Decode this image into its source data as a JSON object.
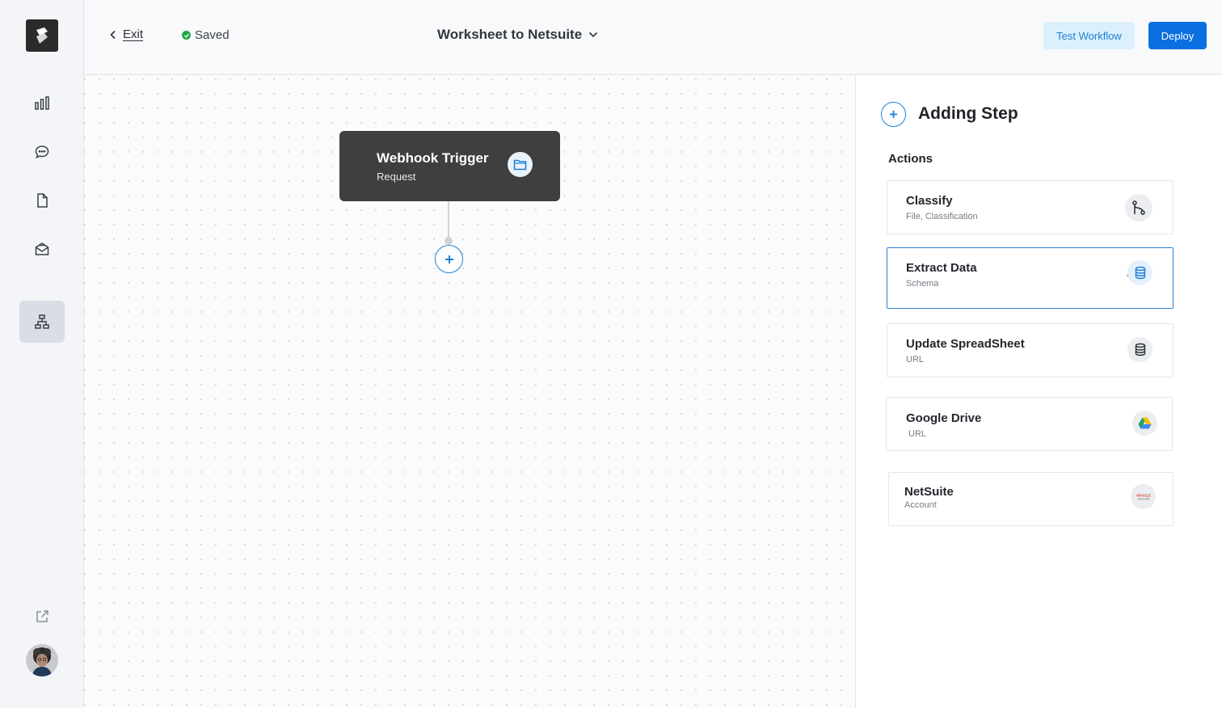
{
  "topbar": {
    "exit_label": "Exit",
    "saved_label": "Saved",
    "workflow_title": "Worksheet to Netsuite",
    "test_button": "Test Workflow",
    "deploy_button": "Deploy"
  },
  "canvas": {
    "trigger": {
      "title": "Webhook Trigger",
      "subtitle": "Request"
    }
  },
  "panel": {
    "title": "Adding Step",
    "section_label": "Actions",
    "cards": [
      {
        "title": "Classify",
        "subtitle": "File, Classification",
        "icon": "git-branch-icon"
      },
      {
        "title": "Extract Data",
        "subtitle": "Schema",
        "icon": "database-icon"
      },
      {
        "title": "Update SpreadSheet",
        "subtitle": "URL",
        "icon": "database-icon"
      },
      {
        "title": "Google Drive",
        "subtitle": "URL",
        "icon": "google-drive-icon"
      },
      {
        "title": "NetSuite",
        "subtitle": "Account",
        "icon": "oracle-netsuite-logo"
      }
    ]
  },
  "colors": {
    "accent": "#0a6fe0",
    "accent_light": "#dcf0fb",
    "trigger_bg": "#3f3f3f",
    "saved_green": "#22a845"
  },
  "logo_text": {
    "netsuite_logo_lettering": "ORACLE NETSUITE"
  }
}
